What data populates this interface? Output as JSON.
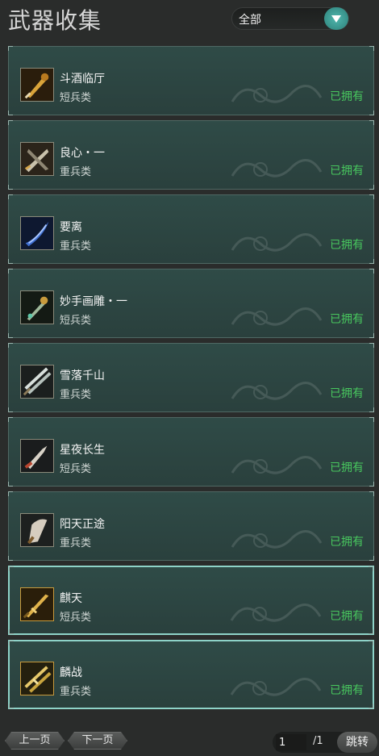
{
  "header": {
    "title": "武器收集",
    "filter": {
      "selected": "全部"
    }
  },
  "weapons": [
    {
      "name": "斗酒临厅",
      "category": "短兵类",
      "status": "已拥有",
      "icon": "golden-dagger-icon",
      "selected": false
    },
    {
      "name": "良心・一",
      "category": "重兵类",
      "status": "已拥有",
      "icon": "crossed-blades-icon",
      "selected": false
    },
    {
      "name": "要离",
      "category": "重兵类",
      "status": "已拥有",
      "icon": "blue-blade-icon",
      "selected": false
    },
    {
      "name": "妙手画雕・一",
      "category": "短兵类",
      "status": "已拥有",
      "icon": "jade-dagger-icon",
      "selected": false
    },
    {
      "name": "雪落千山",
      "category": "重兵类",
      "status": "已拥有",
      "icon": "silver-blades-icon",
      "selected": false
    },
    {
      "name": "星夜长生",
      "category": "短兵类",
      "status": "已拥有",
      "icon": "red-dagger-icon",
      "selected": false
    },
    {
      "name": "阳天正途",
      "category": "重兵类",
      "status": "已拥有",
      "icon": "broad-blade-icon",
      "selected": false
    },
    {
      "name": "麒天",
      "category": "短兵类",
      "status": "已拥有",
      "icon": "gold-sword-icon",
      "selected": true
    },
    {
      "name": "麟战",
      "category": "重兵类",
      "status": "已拥有",
      "icon": "gold-blades-icon",
      "selected": true
    }
  ],
  "pagination": {
    "prev_label": "上一页",
    "next_label": "下一页",
    "current_page": "1",
    "total_label": "/1",
    "jump_label": "跳转"
  },
  "colors": {
    "owned": "#48c75e",
    "card_bg": "#2f4b47",
    "selected_border": "#8ed3c8",
    "accent": "#4fb6ad"
  }
}
